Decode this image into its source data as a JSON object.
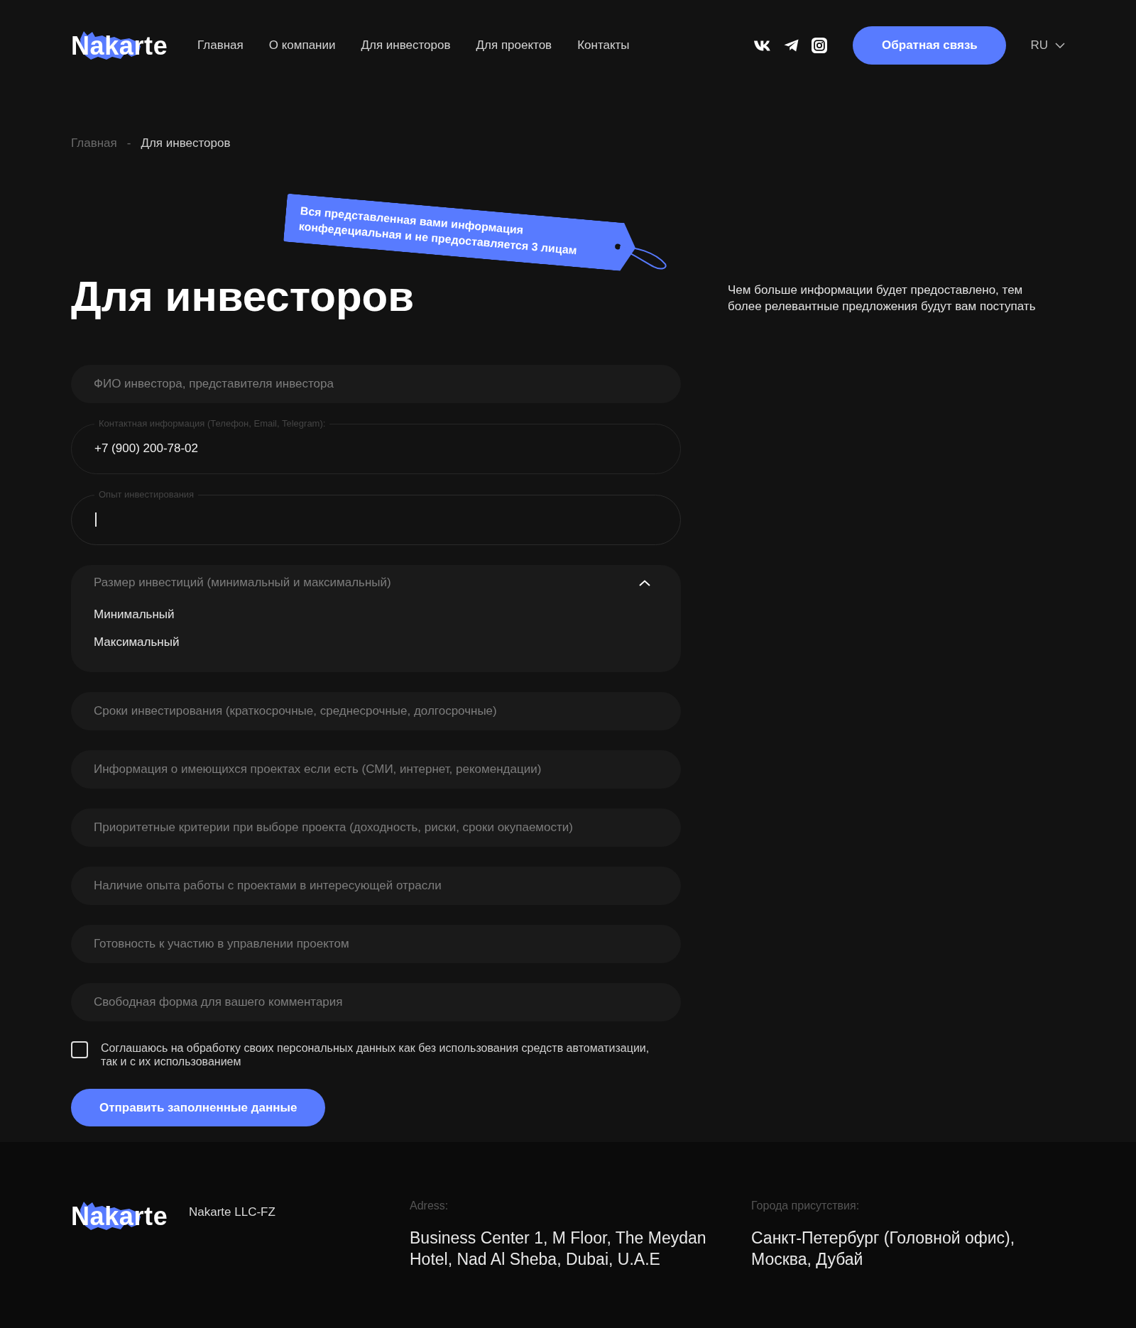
{
  "header": {
    "logo": "Nakarte",
    "nav": [
      "Главная",
      "О компании",
      "Для инвесторов",
      "Для проектов",
      "Контакты"
    ],
    "feedback_button": "Обратная связь",
    "language": "RU"
  },
  "breadcrumb": {
    "items": [
      {
        "label": "Главная",
        "current": false
      },
      {
        "label": "Для инвесторов",
        "current": true
      }
    ],
    "separator": "-"
  },
  "notice_tag": "Вся представленная вами информация конфедециальная и не предоставляется 3 лицам",
  "title": "Для инвесторов",
  "side_note": "Чем больше информации будет предоставлено, тем более релевантные предложения будут вам поступать",
  "form": {
    "fields": [
      {
        "kind": "input",
        "placeholder": "ФИО инвестора, представителя инвестора"
      },
      {
        "kind": "labeled",
        "label": "Контактная информация (Телефон, Email, Telegram):",
        "value": "+7 (900) 200-78-02",
        "focused": false
      },
      {
        "kind": "labeled",
        "label": "Опыт инвестирования",
        "focused": true
      },
      {
        "kind": "select",
        "placeholder": "Размер инвестиций (минимальный и максимальный)",
        "expanded": true,
        "options": [
          {
            "label": "Минимальный",
            "selected": false
          },
          {
            "label": "Максимальный",
            "selected": false
          }
        ]
      },
      {
        "kind": "input",
        "placeholder": "Сроки инвестирования (краткосрочные, среднесрочные, долгосрочные)"
      },
      {
        "kind": "input",
        "placeholder": "Информация о имеющихся проектах если есть (СМИ, интернет, рекомендации)"
      },
      {
        "kind": "input",
        "placeholder": "Приоритетные критерии при выборе проекта (доходность, риски, сроки окупаемости)"
      },
      {
        "kind": "input",
        "placeholder": "Наличие опыта работы с проектами в интересующей отрасли"
      },
      {
        "kind": "input",
        "placeholder": "Готовность к участию в управлении проектом"
      },
      {
        "kind": "input",
        "placeholder": "Свободная форма для вашего комментария"
      }
    ],
    "consent": {
      "label": "Соглашаюсь на обработку своих персональных данных как без использования средств автоматизации, так и с их использованием",
      "checked": false
    },
    "submit": "Отправить заполненные данные"
  },
  "footer": {
    "logo": "Nakarte",
    "company": "Nakarte LLC-FZ",
    "address_label": "Adress:",
    "address": "Business Center 1, M Floor, The Meydan Hotel, Nad Al Sheba, Dubai, U.A.E",
    "cities_label": "Города присутствия:",
    "cities": "Санкт-Петербург (Головной офис), Москва, Дубай"
  }
}
